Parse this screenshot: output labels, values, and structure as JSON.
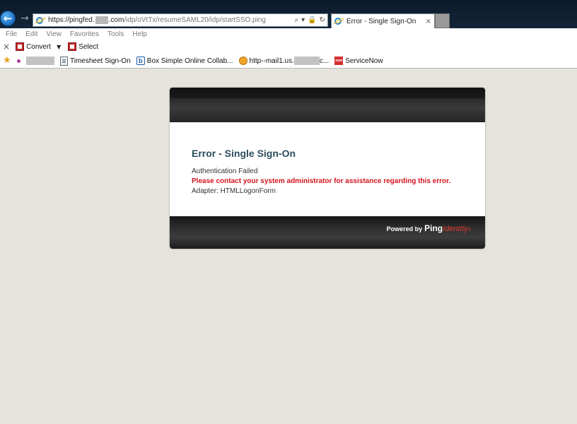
{
  "browser": {
    "address": {
      "url_prefix": "https://pingfed.",
      "url_domain": ".com",
      "url_path": "/idp/oVtTx/resumeSAML20/idp/startSSO.ping",
      "search_glyph": "⌕",
      "dropdown_glyph": "▾",
      "lock_glyph": "🔒",
      "refresh_glyph": "↻"
    },
    "back_glyph": "←",
    "forward_glyph": "→",
    "tab": {
      "title": "Error - Single Sign-On",
      "close": "×"
    }
  },
  "menu": {
    "items": [
      "File",
      "Edit",
      "View",
      "Favorites",
      "Tools",
      "Help"
    ]
  },
  "command_bar": {
    "close_glyph": "×",
    "convert_label": "Convert",
    "dropdown_glyph": "▼",
    "select_label": "Select"
  },
  "favorites": {
    "star_glyph": "★",
    "item_timesheet": "Timesheet Sign-On",
    "box_glyph": "b",
    "item_box": "Box  Simple Online Collab...",
    "item_mail_prefix": "http--mail1.us.",
    "item_mail_suffix": "c...",
    "sn_glyph": "now",
    "item_servicenow": "ServiceNow"
  },
  "error": {
    "title": "Error - Single Sign-On",
    "line1": "Authentication Failed",
    "line2": "Please contact your system administrator for assistance regarding this error.",
    "line3": "Adapter: HTMLLogonForm"
  },
  "footer": {
    "powered_by": "Powered by",
    "brand_ping": "Ping",
    "brand_identity": "Identity",
    "trademark": "®"
  },
  "colors": {
    "page_background": "#e6e2dc",
    "error_title": "#2a4d5e",
    "error_red": "#d3131c",
    "brand_red": "#e03a2f"
  }
}
